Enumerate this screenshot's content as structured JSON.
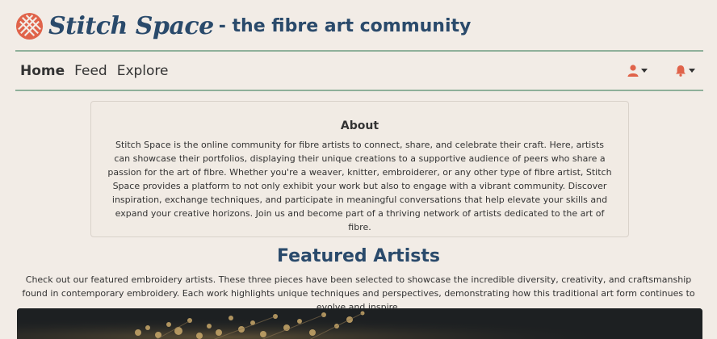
{
  "header": {
    "brand": "Stitch Space",
    "tagline": "- the fibre art community",
    "accent_color": "#e0634a",
    "brand_color": "#2a4a6b"
  },
  "nav": {
    "items": [
      {
        "label": "Home",
        "active": true
      },
      {
        "label": "Feed",
        "active": false
      },
      {
        "label": "Explore",
        "active": false
      }
    ],
    "user_icon": "user-icon",
    "notification_icon": "bell-icon"
  },
  "about": {
    "title": "About",
    "text": "Stitch Space is the online community for fibre artists to connect, share, and celebrate their craft. Here, artists can showcase their portfolios, displaying their unique creations to a supportive audience of peers who share a passion for the art of fibre. Whether you're a weaver, knitter, embroiderer, or any other type of fibre artist, Stitch Space provides a platform to not only exhibit your work but also to engage with a vibrant community. Discover inspiration, exchange techniques, and participate in meaningful conversations that help elevate your skills and expand your creative horizons. Join us and become part of a thriving network of artists dedicated to the art of fibre."
  },
  "featured": {
    "title": "Featured Artists",
    "text": "Check out our featured embroidery artists. These three pieces have been selected to showcase the incredible diversity, creativity, and craftsmanship found in contemporary embroidery. Each work highlights unique techniques and perspectives, demonstrating how this traditional art form continues to evolve and inspire."
  }
}
